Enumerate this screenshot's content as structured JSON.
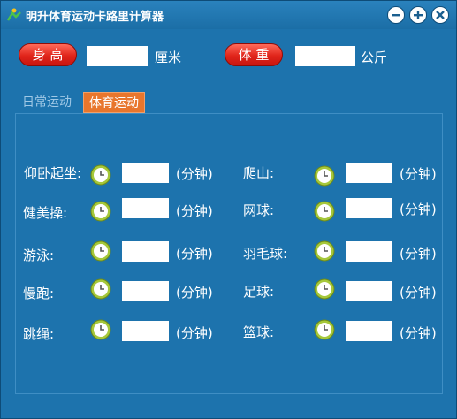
{
  "app": {
    "title": "明升体育运动卡路里计算器"
  },
  "window_controls": {
    "minimize": "minimize",
    "maximize": "maximize",
    "close": "close"
  },
  "body_info": {
    "height_label": "身 高",
    "height_value": "",
    "height_unit": "厘米",
    "weight_label": "体 重",
    "weight_value": "",
    "weight_unit": "公斤"
  },
  "tabs": [
    {
      "label": "日常运动",
      "active": false
    },
    {
      "label": "体育运动",
      "active": true
    }
  ],
  "duration_unit": "(分钟)",
  "sports_left": [
    {
      "label": "仰卧起坐:",
      "value": ""
    },
    {
      "label": "健美操:",
      "value": ""
    },
    {
      "label": "游泳:",
      "value": ""
    },
    {
      "label": "慢跑:",
      "value": ""
    },
    {
      "label": "跳绳:",
      "value": ""
    }
  ],
  "sports_right": [
    {
      "label": "爬山:",
      "value": ""
    },
    {
      "label": "网球:",
      "value": ""
    },
    {
      "label": "羽毛球:",
      "value": ""
    },
    {
      "label": "足球:",
      "value": ""
    },
    {
      "label": "篮球:",
      "value": ""
    }
  ],
  "colors": {
    "accent_red": "#e0241a",
    "tab_active": "#e8762d",
    "background": "#1d73ad"
  }
}
